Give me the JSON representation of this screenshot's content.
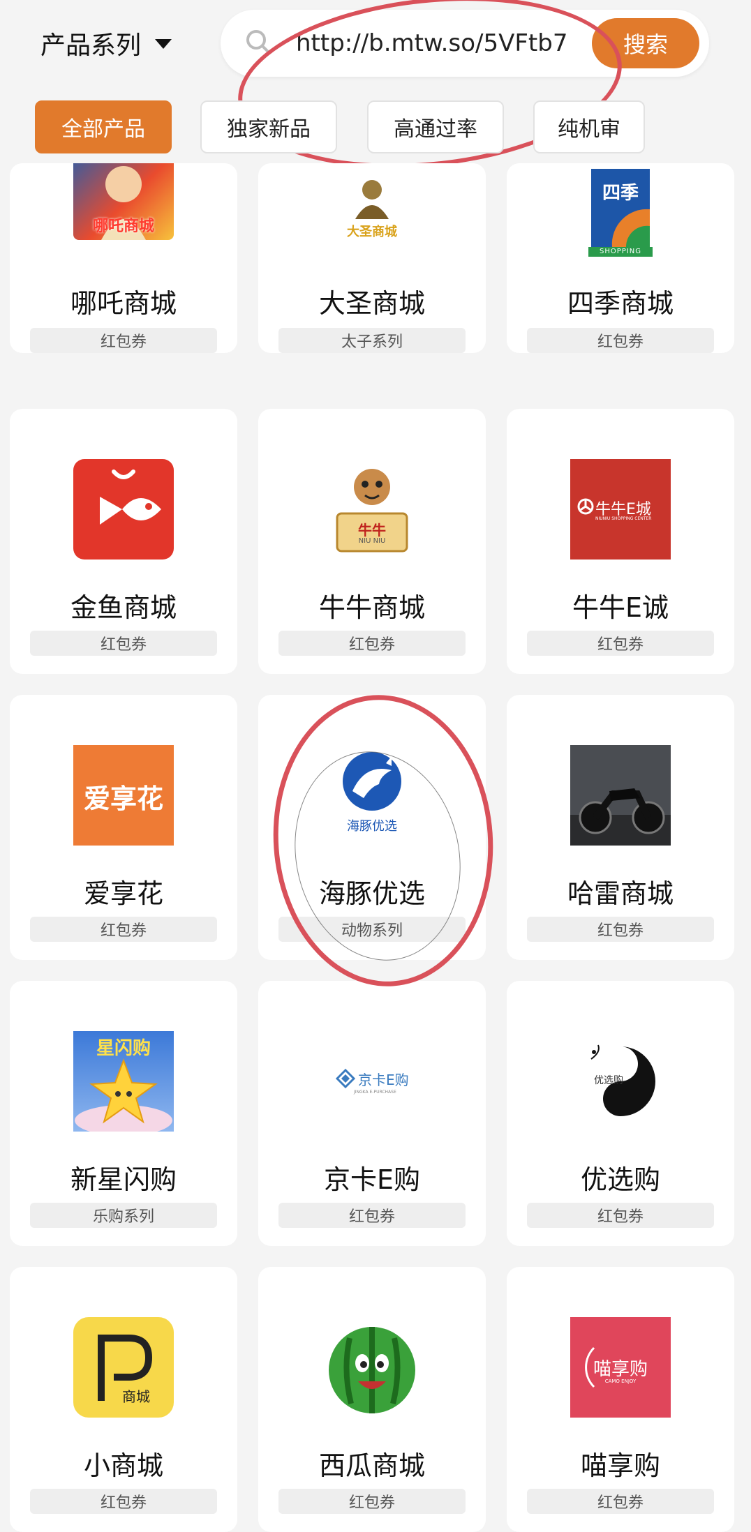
{
  "header": {
    "series_label": "产品系列",
    "search_value": "http://b.mtw.so/5VFtb7",
    "search_button": "搜索"
  },
  "filters": [
    "全部产品",
    "独家新品",
    "高通过率",
    "纯机审"
  ],
  "products": [
    {
      "name": "哪吒商城",
      "tag": "红包券",
      "logo_text": "哪吒商城"
    },
    {
      "name": "大圣商城",
      "tag": "太子系列",
      "logo_text": "大圣商城"
    },
    {
      "name": "四季商城",
      "tag": "红包券",
      "logo_text": "四季",
      "logo_sub": "SHOPPING"
    },
    {
      "name": "金鱼商城",
      "tag": "红包券"
    },
    {
      "name": "牛牛商城",
      "tag": "红包券",
      "logo_text": "牛牛",
      "logo_sub": "NIU NIU"
    },
    {
      "name": "牛牛E诚",
      "tag": "红包券",
      "logo_text": "牛牛E城",
      "logo_sub": "NIUNIU SHOPPING CENTER"
    },
    {
      "name": "爱享花",
      "tag": "红包券",
      "logo_text": "爱享花"
    },
    {
      "name": "海豚优选",
      "tag": "动物系列",
      "logo_text": "海豚优选"
    },
    {
      "name": "哈雷商城",
      "tag": "红包券"
    },
    {
      "name": "新星闪购",
      "tag": "乐购系列",
      "logo_text": "星闪购"
    },
    {
      "name": "京卡E购",
      "tag": "红包券",
      "logo_text": "京卡E购",
      "logo_sub": "JINGKA E-PURCHASE"
    },
    {
      "name": "优选购",
      "tag": "红包券",
      "logo_text": "优选购"
    },
    {
      "name": "小商城",
      "tag": "红包券",
      "logo_text": "商城"
    },
    {
      "name": "西瓜商城",
      "tag": "红包券"
    },
    {
      "name": "喵享购",
      "tag": "红包券",
      "logo_text": "喵享购",
      "logo_sub": "CAMO ENJOY"
    }
  ],
  "colors": {
    "accent": "#e17a2c",
    "annotation": "#d9515a"
  }
}
